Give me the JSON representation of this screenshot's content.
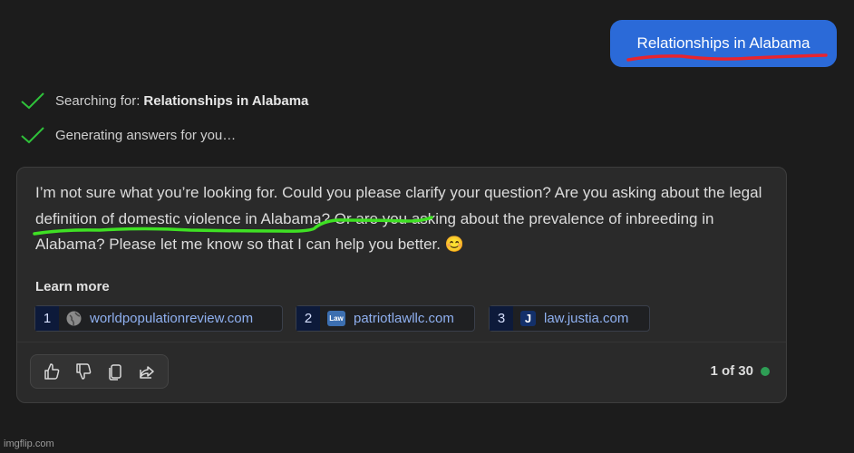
{
  "colors": {
    "background": "#1c1c1c",
    "user_bubble": "#2b6ad8",
    "check": "#2fc23a",
    "red_underline": "#e8242e",
    "green_underline": "#3fe024",
    "status_dot": "#2e9e55"
  },
  "user_message": "Relationships in Alabama",
  "status": {
    "searching_prefix": "Searching for:",
    "searching_query": "Relationships in Alabama",
    "generating": "Generating answers for you…"
  },
  "answer": {
    "part1": "I’m not sure what you’re looking for. Could you please clarify your question? Are you asking about the legal definition of domestic violence in Alabama? Or are you asking about the prevalence of inbreeding in Alabama? Please let me know so that I can help you better.",
    "emoji": "😊"
  },
  "learn_more": {
    "label": "Learn more",
    "sources": [
      {
        "num": "1",
        "icon": "globe-icon",
        "domain": "worldpopulationreview.com"
      },
      {
        "num": "2",
        "icon": "law-logo-icon",
        "icon_text": "Law",
        "domain": "patriotlawllc.com"
      },
      {
        "num": "3",
        "icon": "justia-logo-icon",
        "icon_text": "J",
        "domain": "law.justia.com"
      }
    ]
  },
  "actions": [
    "thumbs-up-icon",
    "thumbs-down-icon",
    "copy-icon",
    "share-icon"
  ],
  "counter": "1 of 30",
  "watermark": "imgflip.com"
}
